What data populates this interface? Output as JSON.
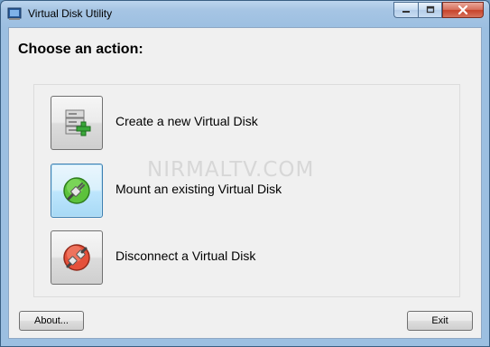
{
  "window": {
    "title": "Virtual Disk Utility",
    "caption_buttons": [
      "minimize",
      "maximize",
      "close"
    ]
  },
  "heading": "Choose an action:",
  "actions": [
    {
      "label": "Create a new Virtual Disk",
      "icon": "create-disk-icon"
    },
    {
      "label": "Mount an existing Virtual Disk",
      "icon": "mount-plug-icon"
    },
    {
      "label": "Disconnect a Virtual Disk",
      "icon": "disconnect-plug-icon"
    }
  ],
  "footer": {
    "about_label": "About...",
    "exit_label": "Exit"
  },
  "watermark": "NIRMALTV.COM",
  "colors": {
    "titlebar": "#9cbfe1",
    "client_bg": "#f0f0f0",
    "close_button": "#c7432a",
    "focus_border": "#3c7fb1"
  }
}
